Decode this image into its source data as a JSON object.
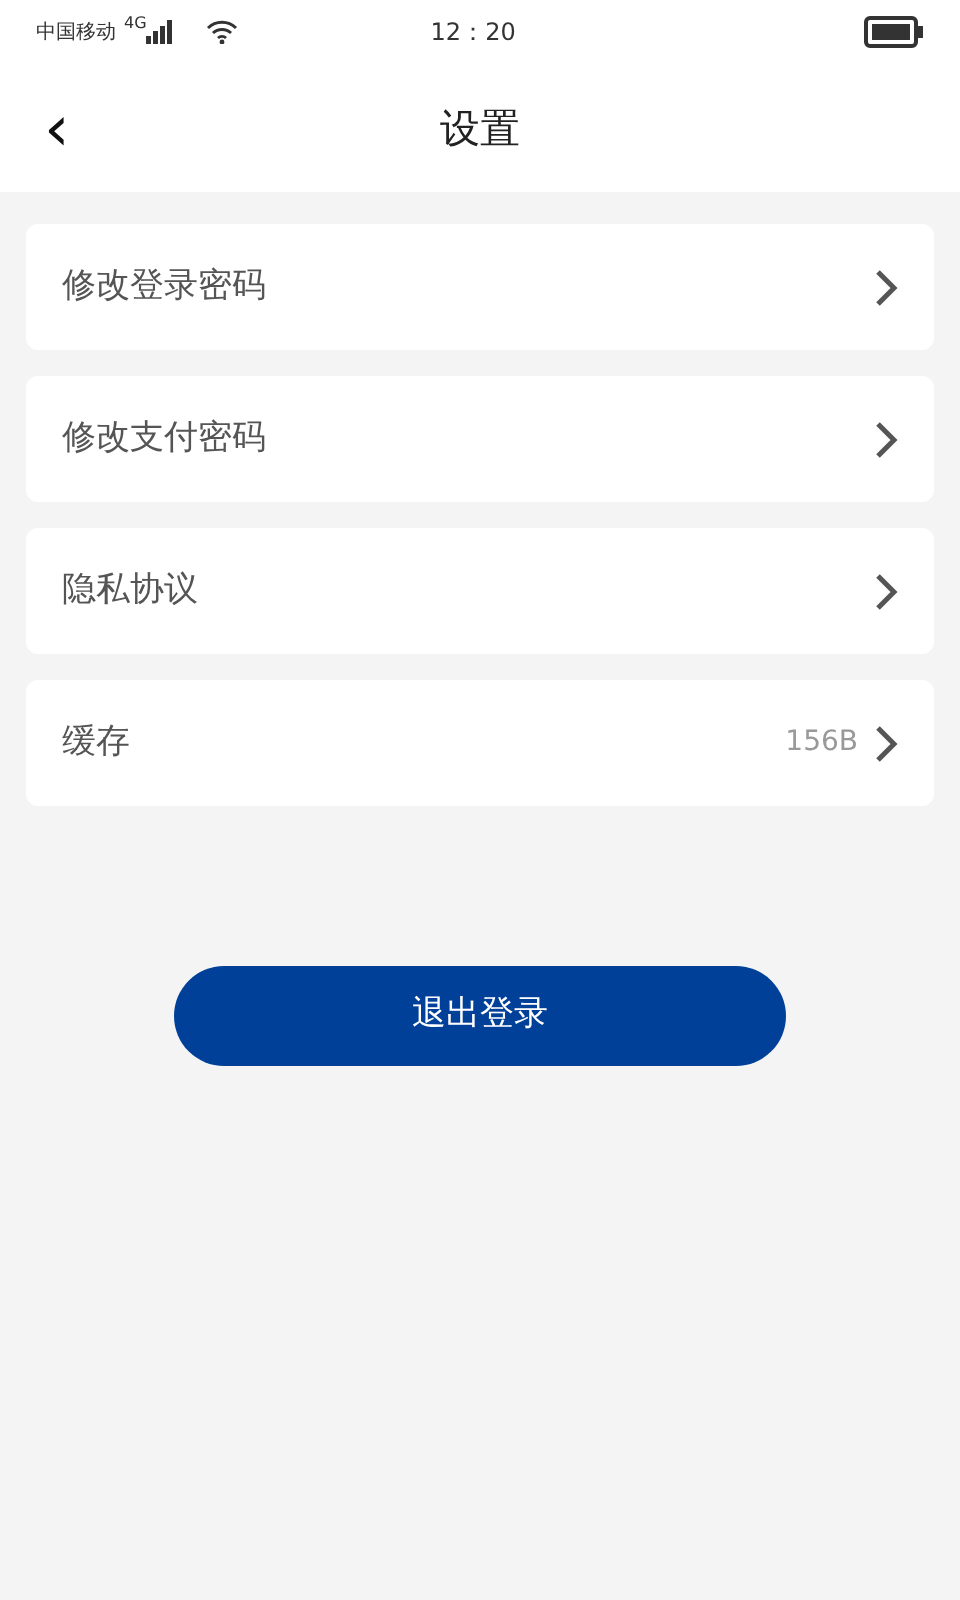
{
  "status_bar": {
    "carrier": "中国移动",
    "network": "4G",
    "time": "12：20"
  },
  "header": {
    "back_icon": "‹",
    "title": "设置"
  },
  "items": [
    {
      "label": "修改登录密码"
    },
    {
      "label": "修改支付密码"
    },
    {
      "label": "隐私协议"
    },
    {
      "label": "缓存",
      "value": "156B"
    }
  ],
  "logout_button": "退出登录"
}
